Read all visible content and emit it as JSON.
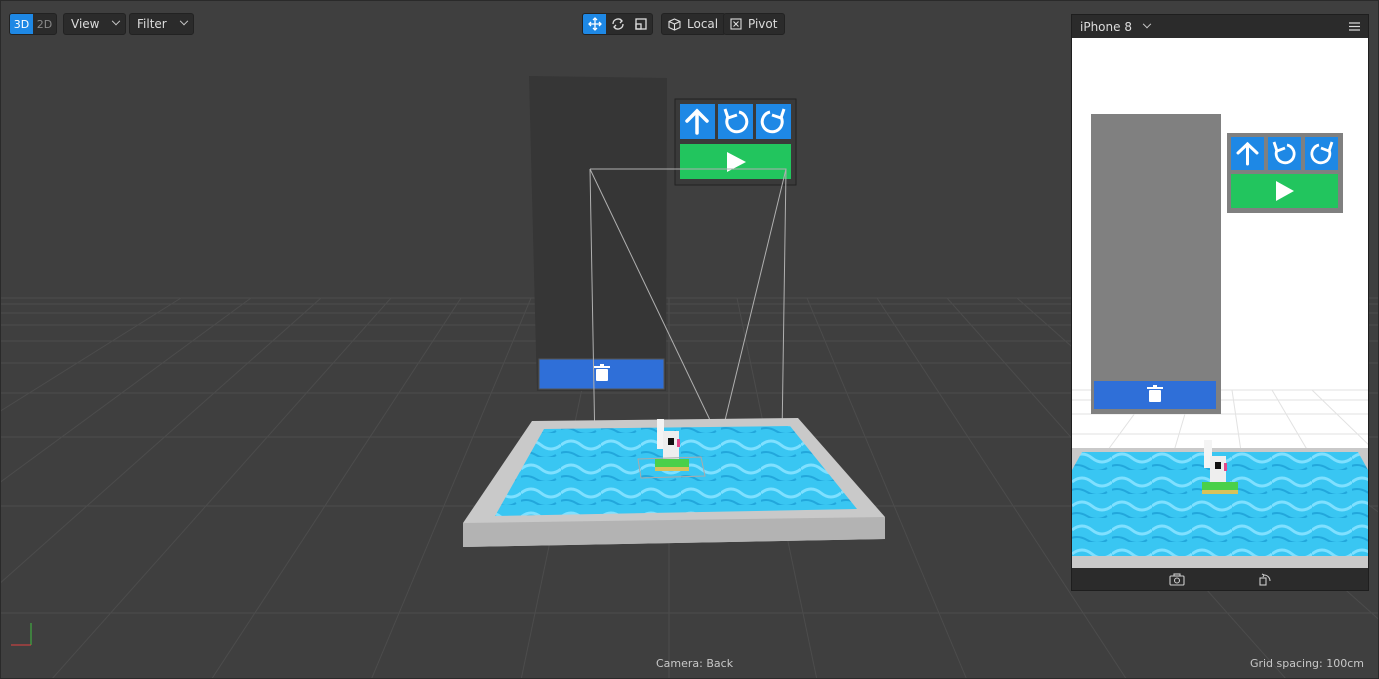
{
  "toolbar": {
    "mode_3d": "3D",
    "mode_2d": "2D",
    "view_label": "View",
    "filter_label": "Filter",
    "local_label": "Local",
    "pivot_label": "Pivot"
  },
  "device": {
    "name": "iPhone 8"
  },
  "status": {
    "camera": "Camera: Back",
    "grid": "Grid spacing: 100cm"
  },
  "colors": {
    "accent": "#1e88e5",
    "ui_blue": "#2f6fd8",
    "ui_green": "#22c55e",
    "water": "#3cc8f0",
    "rim": "#c8c8c8"
  },
  "icons": [
    "move-tool-icon",
    "rotate-tool-icon",
    "scale-tool-icon",
    "cube-icon",
    "pivot-icon",
    "menu-icon",
    "screenshot-icon",
    "rotate-device-icon",
    "arrow-up-icon",
    "undo-icon",
    "redo-icon",
    "play-icon",
    "trash-icon"
  ]
}
